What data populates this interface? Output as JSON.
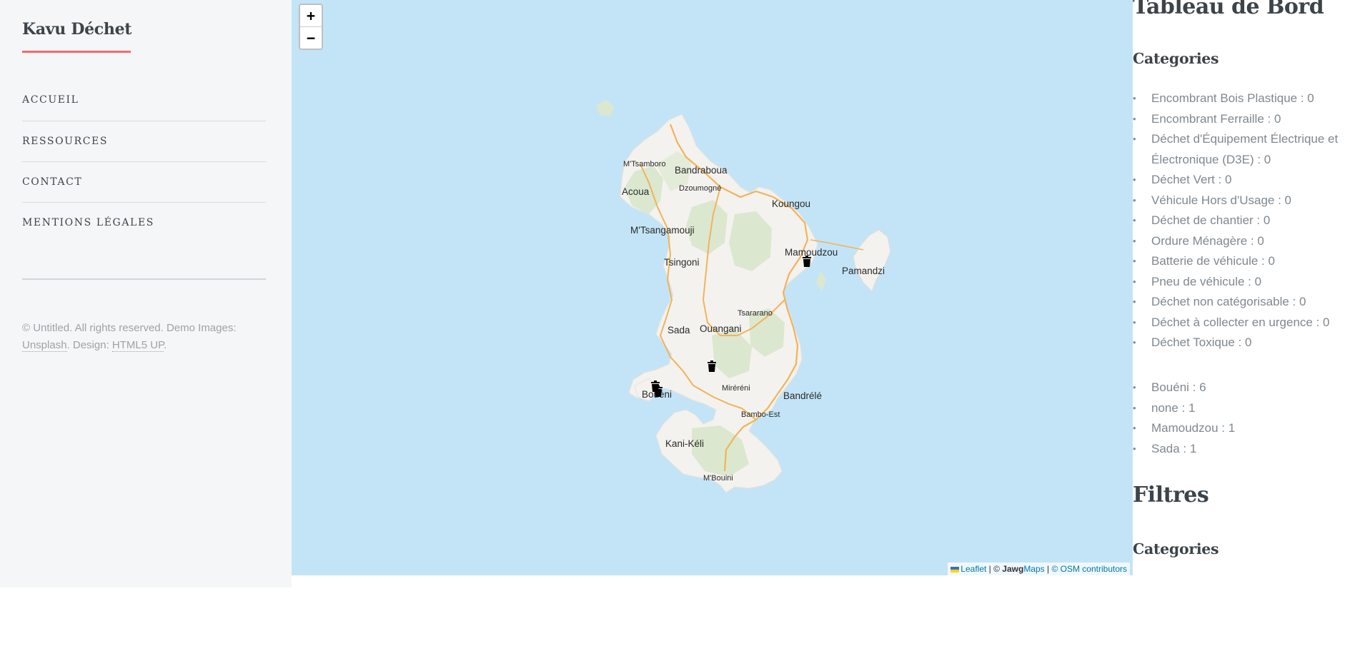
{
  "sidebar": {
    "brand": "Kavu Déchet",
    "menu": [
      "ACCUEIL",
      "RESSOURCES",
      "CONTACT",
      "MENTIONS LÉGALES"
    ],
    "footer": {
      "copyright": "© Untitled. All rights reserved. Demo Images: ",
      "unsplash": "Unsplash",
      "design_text": ". Design: ",
      "html5up": "HTML5 UP",
      "end": "."
    },
    "colors": {
      "background": "#f5f6f7",
      "accent": "#f56a6a"
    }
  },
  "map": {
    "zoom_in": "+",
    "zoom_out": "−",
    "attribution": {
      "leaflet": "Leaflet",
      "sep1": " | © ",
      "jawg_bold": "Jawg",
      "jawg_maps": "Maps",
      "sep2": " | ",
      "osm": "© OSM contributors"
    },
    "places": {
      "mtsamboro": "M'Tsamboro",
      "bandraboua": "Bandraboua",
      "acoua": "Acoua",
      "dzoumogne": "Dzoumogné",
      "koungou": "Koungou",
      "mtsangamouji": "M'Tsangamouji",
      "mamoudzou": "Mamoudzou",
      "pamandzi": "Pamandzi",
      "tsingoni": "Tsingoni",
      "tsararano": "Tsararano",
      "sada": "Sada",
      "ouangani": "Ouangani",
      "mireremi": "Miréréni",
      "boueni": "Bouéni",
      "bandrele": "Bandrélé",
      "bambo_est": "Bambo-Est",
      "kani_keli": "Kani-Kéli",
      "mbouini": "M'Bouini"
    },
    "marker_icon": "trash-icon",
    "colors": {
      "water": "#c3e4f7",
      "land": "#f4f2ee",
      "forest": "#dbe8cf",
      "road": "#f2b35a"
    }
  },
  "panel": {
    "title": "Tableau de Bord",
    "categories_heading": "Categories",
    "categories": [
      "Encombrant Bois Plastique : 0",
      "Encombrant Ferraille : 0",
      "Déchet d'Équipement Électrique et Électronique (D3E) : 0",
      "Déchet Vert : 0",
      "Véhicule Hors d'Usage : 0",
      "Déchet de chantier : 0",
      "Ordure Ménagère : 0",
      "Batterie de véhicule : 0",
      "Pneu de véhicule : 0",
      "Déchet non catégorisable : 0",
      "Déchet à collecter en urgence : 0",
      "Déchet Toxique : 0"
    ],
    "communes": [
      "Bouéni : 6",
      "none : 1",
      "Mamoudzou : 1",
      "Sada : 1"
    ],
    "filters_title": "Filtres",
    "filters_categories_heading": "Categories"
  }
}
